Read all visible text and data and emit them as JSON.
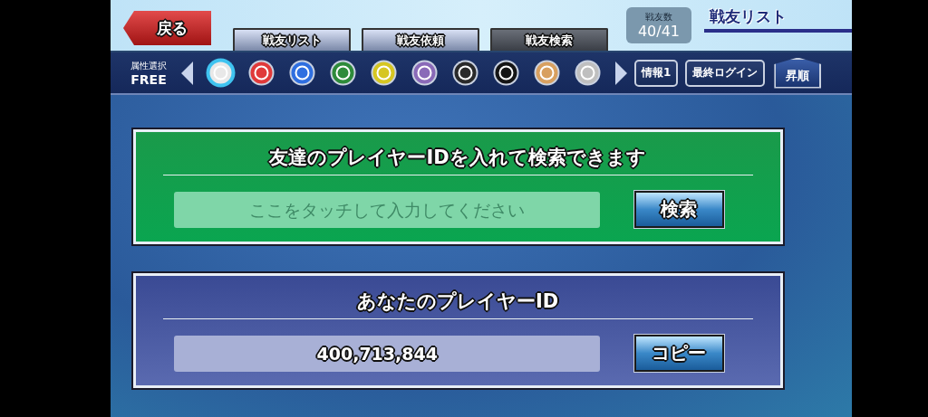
{
  "back_button": "戻る",
  "tabs": [
    {
      "label": "戦友リスト",
      "selected": false
    },
    {
      "label": "戦友依頼",
      "selected": false
    },
    {
      "label": "戦友検索",
      "selected": true
    }
  ],
  "friend_count": {
    "label": "戦友数",
    "value": "40/41"
  },
  "screen_title": "戦友リスト",
  "filter_bar": {
    "attribute_label": "属性選択",
    "attribute_value": "FREE",
    "attributes": [
      {
        "color": "#e8e8e8",
        "selected": true
      },
      {
        "color": "#e03a3a",
        "selected": false
      },
      {
        "color": "#2f6fe0",
        "selected": false
      },
      {
        "color": "#2e8b3a",
        "selected": false
      },
      {
        "color": "#d6c622",
        "selected": false
      },
      {
        "color": "#8a6ab8",
        "selected": false
      },
      {
        "color": "#2a2a2a",
        "selected": false
      },
      {
        "color": "#151515",
        "selected": false
      },
      {
        "color": "#d8a060",
        "selected": false
      },
      {
        "color": "#bfbfbf",
        "selected": false
      }
    ],
    "info_button": "情報1",
    "sort_key_button": "最終ログイン",
    "order_button": "昇順"
  },
  "search_panel": {
    "title": "友達のプレイヤーIDを入れて検索できます",
    "placeholder": "ここをタッチして入力してください",
    "button": "検索"
  },
  "id_panel": {
    "title": "あなたのプレイヤーID",
    "value": "400,713,844",
    "button": "コピー"
  }
}
